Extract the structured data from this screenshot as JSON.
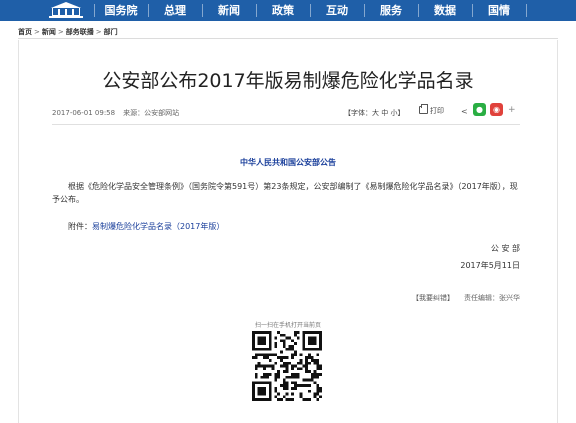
{
  "nav": {
    "items": [
      "国务院",
      "总理",
      "新闻",
      "政策",
      "互动",
      "服务",
      "数据",
      "国情"
    ]
  },
  "breadcrumb": [
    "首页",
    "新闻",
    "部务联播",
    "部门"
  ],
  "breadcrumb_sep": ">",
  "article": {
    "title": "公安部公布2017年版易制爆危险化学品名录",
    "date": "2017-06-01 09:58",
    "source_label": "来源：",
    "source": "公安部网站",
    "font_size": "【字体：大 中 小】",
    "print": "打印",
    "announcement": "中华人民共和国公安部公告",
    "paragraph1": "根据《危险化学品安全管理条例》（国务院令第591号）第23条规定，公安部编制了《易制爆危险化学品名录》（2017年版），现予公布。",
    "attachment_label": "附件：",
    "attachment_link": "易制爆危险化学品名录（2017年版）",
    "signatory": "公 安 部",
    "sign_date": "2017年5月11日",
    "report_error": "【我要纠错】",
    "editor": "责任编辑：张兴华",
    "qr_caption": "扫一扫在手机打开当前页"
  },
  "colors": {
    "nav_bg": "#1f5fa8",
    "link_blue": "#1a3f9b",
    "wechat": "#2aae43",
    "weibo": "#e0413b"
  },
  "icons": [
    "gov-logo-icon",
    "printer-icon",
    "share-icon",
    "wechat-icon",
    "weibo-icon",
    "plus-icon",
    "qr-code-icon"
  ]
}
